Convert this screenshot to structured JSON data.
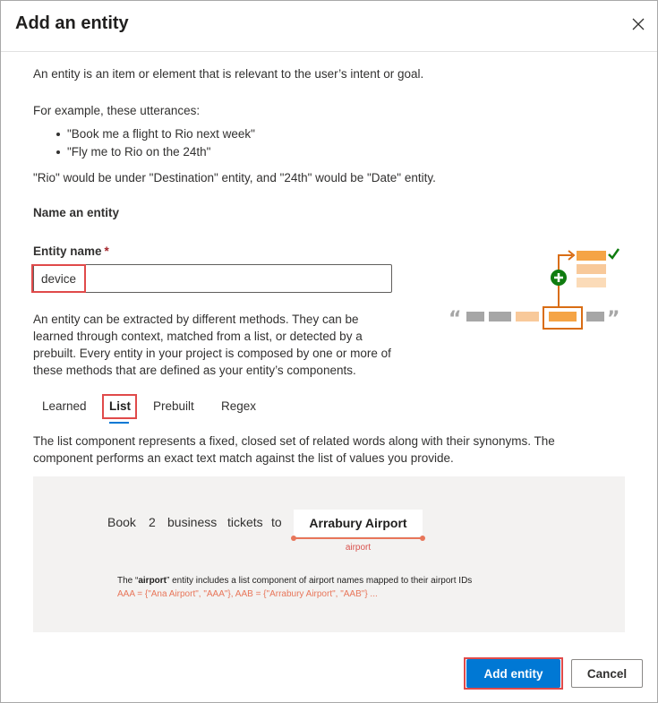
{
  "dialog": {
    "title": "Add an entity",
    "close_icon": "close-icon"
  },
  "intro": {
    "definition": "An entity is an item or element that is relevant to the user’s intent or goal.",
    "example_lead": "For example, these utterances:",
    "examples": [
      "\"Book me a flight to Rio next week\"",
      "\"Fly me to Rio on the 24th\""
    ],
    "explanation": "\"Rio\" would be under \"Destination\" entity, and \"24th\" would be \"Date\" entity."
  },
  "form": {
    "section_heading": "Name an entity",
    "entity_name_label": "Entity name",
    "required_marker": "*",
    "entity_name_value": "device"
  },
  "methods": {
    "description": "An entity can be extracted by different methods. They can be learned through context, matched from a list, or detected by a prebuilt. Every entity in your project is composed by one or more of these methods that are defined as your entity’s components."
  },
  "tabs": [
    {
      "label": "Learned"
    },
    {
      "label": "List",
      "selected": true
    },
    {
      "label": "Prebuilt"
    },
    {
      "label": "Regex"
    }
  ],
  "list_tab": {
    "description": "The list component represents a fixed, closed set of related words along with their synonyms. The component performs an exact text match against the list of values you provide.",
    "example": {
      "words": [
        "Book",
        "2",
        "business",
        "tickets",
        "to"
      ],
      "entity_text": "Arrabury Airport",
      "entity_tag": "airport",
      "note_prefix": "The “",
      "note_entity": "airport",
      "note_suffix": "” entity includes a list component of airport names mapped to their airport IDs",
      "note_values": "AAA = {\"Ana Airport\", \"AAA\"}, AAB = {\"Arrabury Airport\", \"AAB\"} ..."
    }
  },
  "footer": {
    "primary_label": "Add entity",
    "secondary_label": "Cancel"
  },
  "colors": {
    "primary": "#0078d4",
    "highlight": "#e04a4a",
    "accent_orange": "#e8765a",
    "illustration_orange": "#d96d14",
    "illustration_green": "#107c10"
  }
}
